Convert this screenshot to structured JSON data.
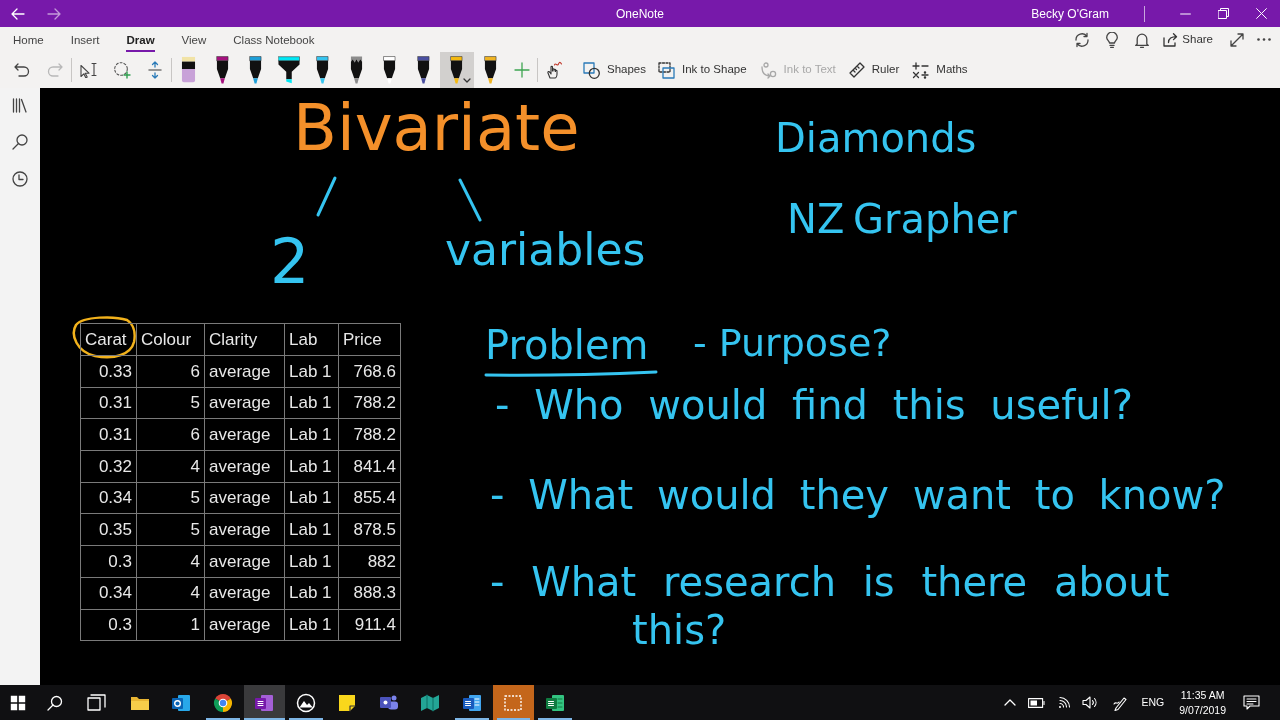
{
  "title_bar": {
    "navigation": [
      {
        "kind": "back",
        "disabled": false
      },
      {
        "kind": "forward",
        "disabled": true
      }
    ],
    "title": "OneNote",
    "user": "Becky O'Gram"
  },
  "ribbon": {
    "tabs": [
      {
        "label": "Home",
        "selected": false
      },
      {
        "label": "Insert",
        "selected": false
      },
      {
        "label": "Draw",
        "selected": true
      },
      {
        "label": "View",
        "selected": false
      },
      {
        "label": "Class Notebook",
        "selected": false
      }
    ],
    "share_label": "Share",
    "history": [
      {
        "kind": "undo",
        "disabled": false
      },
      {
        "kind": "redo",
        "disabled": true
      }
    ],
    "pens": [
      {
        "kind": "eraser",
        "color": "#c8a2d8",
        "selected": false
      },
      {
        "kind": "pen",
        "color": "#a5127e",
        "selected": false
      },
      {
        "kind": "pen",
        "color": "#1e9fd8",
        "selected": false
      },
      {
        "kind": "highlighter",
        "color": "#00e8f5",
        "selected": false
      },
      {
        "kind": "pen",
        "color": "#36c5f0",
        "selected": false
      },
      {
        "kind": "pencil",
        "color": "#8c8c8c",
        "selected": false
      },
      {
        "kind": "pen",
        "color": "#ffffff",
        "selected": false
      },
      {
        "kind": "pen",
        "color": "#4a4fa0",
        "selected": false
      },
      {
        "kind": "pen",
        "color": "#f5b910",
        "selected": true
      },
      {
        "kind": "pen",
        "color": "#f0b422",
        "selected": false
      }
    ],
    "commands": [
      {
        "kind": "touch_draw",
        "disabled": false
      },
      {
        "kind": "shapes",
        "label": "Shapes",
        "disabled": false
      },
      {
        "kind": "ink_to_shape",
        "label": "Ink to Shape",
        "disabled": false
      },
      {
        "kind": "ink_to_text",
        "label": "Ink to Text",
        "disabled": true
      },
      {
        "kind": "ruler",
        "label": "Ruler",
        "disabled": false
      },
      {
        "kind": "maths",
        "label": "Maths",
        "disabled": false
      }
    ]
  },
  "page": {
    "ink": [
      {
        "text": "Bivariate",
        "color": "#f4902a"
      },
      {
        "text": "2",
        "color": "#35c4f0"
      },
      {
        "text": "variables",
        "color": "#35c4f0"
      },
      {
        "text": "Diamonds",
        "color": "#35c4f0"
      },
      {
        "text": "NZ Grapher",
        "color": "#35c4f0"
      },
      {
        "text": "Problem",
        "color": "#35c4f0"
      },
      {
        "text": "- Purpose?",
        "color": "#35c4f0"
      },
      {
        "text": "- Who would find this useful?",
        "color": "#35c4f0"
      },
      {
        "text": "- What would they want to know?",
        "color": "#35c4f0"
      },
      {
        "text": "- What research is there about",
        "color": "#35c4f0"
      },
      {
        "text": "this?",
        "color": "#35c4f0"
      }
    ],
    "table": {
      "columns": [
        {
          "label": "Carat",
          "kind": "number"
        },
        {
          "label": "Colour",
          "kind": "number"
        },
        {
          "label": "Clarity",
          "kind": "text"
        },
        {
          "label": "Lab",
          "kind": "text"
        },
        {
          "label": "Price",
          "kind": "number"
        }
      ],
      "rows": [
        [
          "0.33",
          "6",
          "average",
          "Lab 1",
          "768.6"
        ],
        [
          "0.31",
          "5",
          "average",
          "Lab 1",
          "788.2"
        ],
        [
          "0.31",
          "6",
          "average",
          "Lab 1",
          "788.2"
        ],
        [
          "0.32",
          "4",
          "average",
          "Lab 1",
          "841.4"
        ],
        [
          "0.34",
          "5",
          "average",
          "Lab 1",
          "855.4"
        ],
        [
          "0.35",
          "5",
          "average",
          "Lab 1",
          "878.5"
        ],
        [
          "0.3",
          "4",
          "average",
          "Lab 1",
          "882"
        ],
        [
          "0.34",
          "4",
          "average",
          "Lab 1",
          "888.3"
        ],
        [
          "0.3",
          "1",
          "average",
          "Lab 1",
          "911.4"
        ]
      ]
    }
  },
  "taskbar": {
    "apps": [
      {
        "kind": "folder",
        "running": false,
        "selected": false,
        "flashing": false
      },
      {
        "kind": "mail",
        "running": false,
        "selected": false,
        "flashing": false
      },
      {
        "kind": "browser",
        "running": true,
        "selected": false,
        "flashing": false
      },
      {
        "kind": "notebook",
        "running": true,
        "selected": true,
        "flashing": false
      },
      {
        "kind": "photos",
        "running": true,
        "selected": false,
        "flashing": false
      },
      {
        "kind": "sticky_notes",
        "running": false,
        "selected": false,
        "flashing": false
      },
      {
        "kind": "chat",
        "running": false,
        "selected": false,
        "flashing": false
      },
      {
        "kind": "maps",
        "running": false,
        "selected": false,
        "flashing": false
      },
      {
        "kind": "document",
        "running": true,
        "selected": false,
        "flashing": false
      },
      {
        "kind": "snip",
        "running": true,
        "selected": false,
        "flashing": true
      },
      {
        "kind": "spreadsheet",
        "running": true,
        "selected": false,
        "flashing": false
      }
    ],
    "language": "ENG",
    "time": "11:35 AM",
    "date": "9/07/2019"
  }
}
